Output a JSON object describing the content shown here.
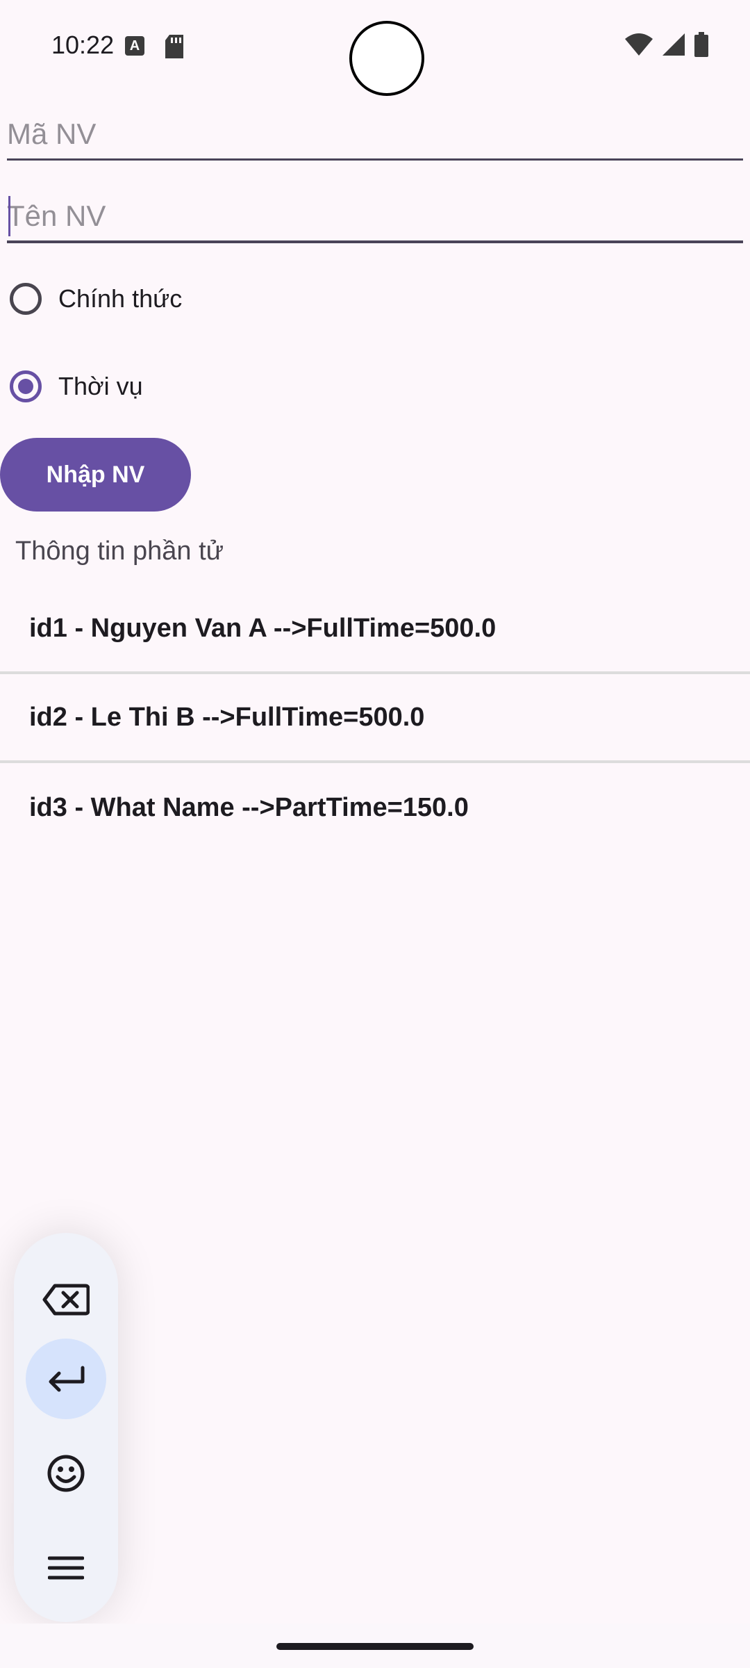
{
  "status_bar": {
    "time": "10:22"
  },
  "form": {
    "ma_nv_placeholder": "Mã NV",
    "ma_nv_value": "",
    "ten_nv_placeholder": "Tên NV",
    "ten_nv_value": "",
    "radio_chinh_thuc_label": "Chính thức",
    "radio_thoi_vu_label": "Thời vụ",
    "selected_option": "Thời vụ",
    "submit_label": "Nhập NV"
  },
  "section_label": "Thông tin phần tử",
  "employees": [
    "id1 - Nguyen Van A -->FullTime=500.0",
    "id2 - Le Thi B -->FullTime=500.0",
    "id3 - What Name -->PartTime=150.0"
  ],
  "keyboard_toolbar": {
    "icons": [
      "backspace-icon",
      "enter-icon",
      "emoji-icon",
      "menu-icon"
    ],
    "active_icon": "enter-icon"
  },
  "colors": {
    "accent": "#6750a4",
    "background": "#fdf7fb",
    "toolbar_active": "#d6e3fc"
  }
}
